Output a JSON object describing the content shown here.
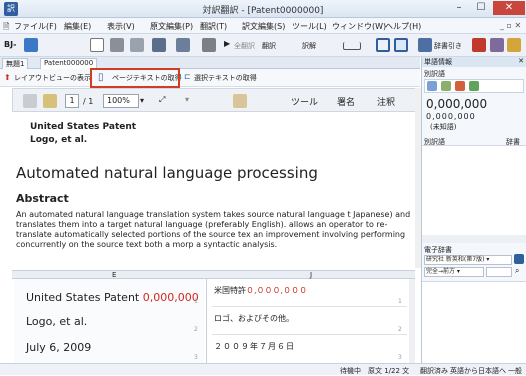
{
  "window": {
    "title": "対訳翻訳 - [Patent0000000]"
  },
  "menu": [
    "ファイル(F)",
    "編集(E)",
    "表示(V)",
    "原文編集(P)",
    "翻訳(T)",
    "訳文編集(S)",
    "ツール(L)",
    "ウィンドウ(W)",
    "ヘルプ(H)"
  ],
  "toolbar1": {
    "mode_label": "BJ-",
    "zennotrans": "全翻訳",
    "trans": "翻訳",
    "yakubun": "訳解",
    "dict_label": "辞書引き"
  },
  "tabs": [
    "無題1",
    "Patent000000"
  ],
  "toolbar2": {
    "layout_label": "レイアウトビューの表示",
    "page_text_label": "ページテキストの取得",
    "select_text_label": "選択テキストの取得"
  },
  "toolbar3": {
    "page_current": "1",
    "page_total": "/ 1",
    "zoom": "100%",
    "tool_label": "ツール",
    "sign_label": "署名",
    "note_label": "注釈"
  },
  "document": {
    "patent_line": "United States Patent",
    "inventor_line": "Logo, et al.",
    "title": "Automated natural language processing",
    "abstract_heading": "Abstract",
    "abstract_text": "An automated natural language translation system takes source natural language t Japanese) and translates them into a target natural language (preferably English). allows an operator to re-translate automatically selected portions of the source tex an improvement involving performing concurrently on the source text both a morp a syntactic analysis."
  },
  "columns": {
    "source_header": "E",
    "target_header": "J"
  },
  "segments": [
    {
      "src_text": "United States Patent",
      "src_num": "0,000,000",
      "tgt_text": "米国特許",
      "tgt_num": "０,０００,０００",
      "index": "1"
    },
    {
      "src_text": "Logo, et al.",
      "src_num": "",
      "tgt_text": "ロゴ、およびその他。",
      "tgt_num": "",
      "index": "2"
    },
    {
      "src_text": "July 6, 2009",
      "src_num": "",
      "tgt_text": "２００９年７月６日",
      "tgt_num": "",
      "index": "3"
    }
  ],
  "right_pane": {
    "title": "単語情報",
    "subtitle": "別訳語",
    "number_big": "0,000,000",
    "number_small": "0,000,000",
    "unknown": "(未知語)",
    "col_alt": "別訳語",
    "col_dict": "辞書",
    "edict_title": "電子辞書",
    "dict_select": "研究社 新英和(第7版) ▾",
    "match_select": "完全→前方 ▾"
  },
  "status": {
    "state": "待機中",
    "page_info": "原文 1/22 文",
    "done": "翻訳済み",
    "direction": "英語から日本語へ",
    "mode": "一般"
  },
  "colors": {
    "highlight": "#d23b24",
    "number_red": "#d2291f",
    "accent": "#2f5f9e"
  }
}
